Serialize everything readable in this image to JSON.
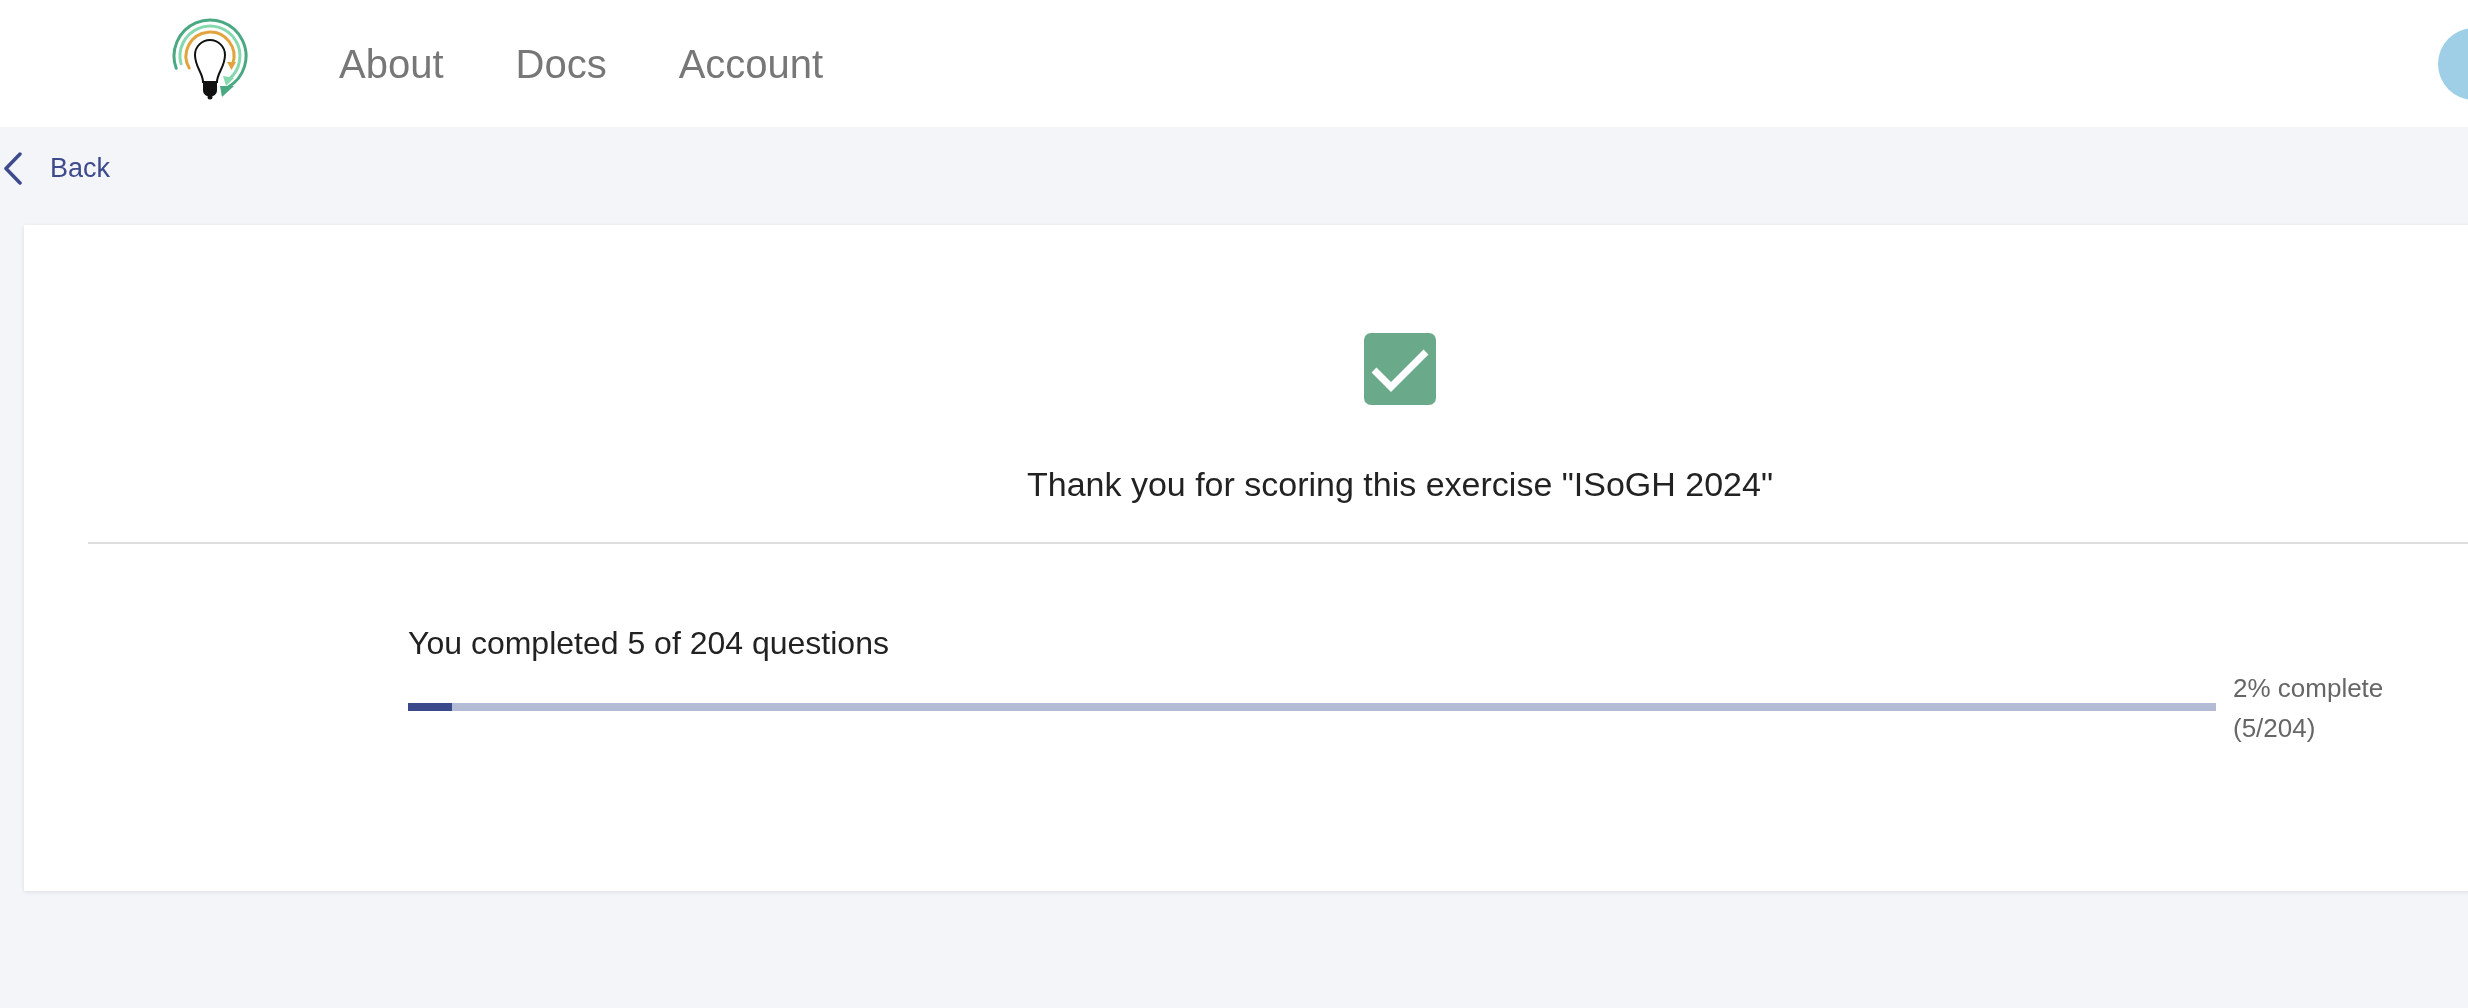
{
  "header": {
    "nav": [
      "About",
      "Docs",
      "Account"
    ]
  },
  "back_link": {
    "label": "Back"
  },
  "result": {
    "title": "Thank you for scoring this exercise \"ISoGH 2024\"",
    "summary": "You completed 5 of 204 questions",
    "progress": {
      "level": 0.0245,
      "percent_label": "2% complete",
      "count_label": "(5/204)"
    }
  }
}
